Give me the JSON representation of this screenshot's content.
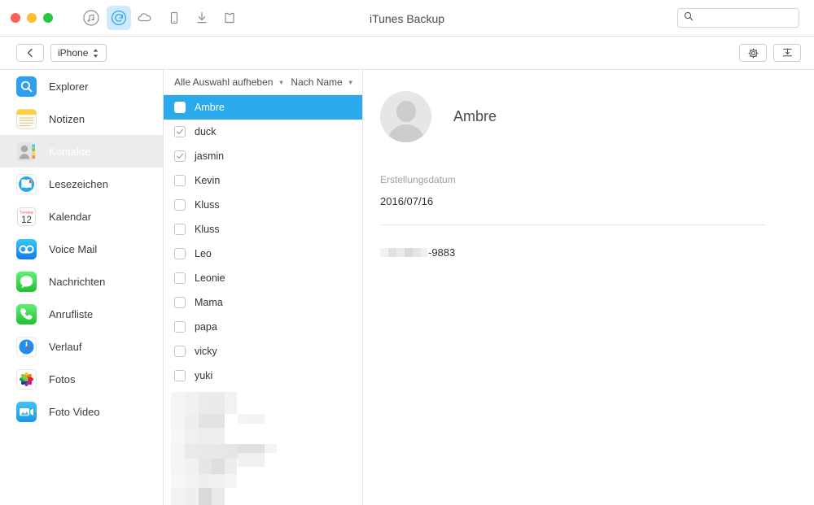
{
  "window": {
    "title": "iTunes Backup",
    "traffic_lights": [
      "close",
      "minimize",
      "maximize"
    ],
    "colors": {
      "close": "#ff5f57",
      "minimize": "#febc2e",
      "maximize": "#28c840",
      "accent": "#2aa9ec",
      "active_tool_bg": "#cfe8fb"
    }
  },
  "toolbar": {
    "items": [
      {
        "name": "music-icon",
        "label": "Music"
      },
      {
        "name": "backup-restore-icon",
        "label": "iTunes Backup",
        "active": true
      },
      {
        "name": "cloud-icon",
        "label": "iCloud"
      },
      {
        "name": "device-icon",
        "label": "Device"
      },
      {
        "name": "download-icon",
        "label": "Download"
      },
      {
        "name": "shirt-icon",
        "label": "Toolkit"
      }
    ]
  },
  "search": {
    "value": "",
    "placeholder": ""
  },
  "subbar": {
    "back_label": "",
    "device_label": "iPhone",
    "settings_label": "",
    "export_label": ""
  },
  "sidebar": {
    "items": [
      {
        "label": "Explorer",
        "icon": "explorer-icon",
        "selected": false
      },
      {
        "label": "Notizen",
        "icon": "notes-icon",
        "selected": false
      },
      {
        "label": "Kontakte",
        "icon": "contacts-icon",
        "selected": true
      },
      {
        "label": "Lesezeichen",
        "icon": "bookmarks-icon",
        "selected": false
      },
      {
        "label": "Kalendar",
        "icon": "calendar-icon",
        "selected": false
      },
      {
        "label": "Voice Mail",
        "icon": "voicemail-icon",
        "selected": false
      },
      {
        "label": "Nachrichten",
        "icon": "messages-icon",
        "selected": false
      },
      {
        "label": "Anrufliste",
        "icon": "call-history-icon",
        "selected": false
      },
      {
        "label": "Verlauf",
        "icon": "history-icon",
        "selected": false
      },
      {
        "label": "Fotos",
        "icon": "photos-icon",
        "selected": false
      },
      {
        "label": "Foto Video",
        "icon": "photo-video-icon",
        "selected": false
      }
    ],
    "calendar_icon_day": "12",
    "calendar_icon_weekday": "Tuesday"
  },
  "list": {
    "header": {
      "deselect_all_label": "Alle Auswahl aufheben",
      "sort_label": "Nach Name"
    },
    "rows": [
      {
        "name": "Ambre",
        "checked": true,
        "selected": true
      },
      {
        "name": "duck",
        "checked": true,
        "selected": false
      },
      {
        "name": "jasmin",
        "checked": true,
        "selected": false
      },
      {
        "name": "Kevin",
        "checked": false,
        "selected": false
      },
      {
        "name": "Kluss",
        "checked": false,
        "selected": false
      },
      {
        "name": "Kluss",
        "checked": false,
        "selected": false
      },
      {
        "name": "Leo",
        "checked": false,
        "selected": false
      },
      {
        "name": "Leonie",
        "checked": false,
        "selected": false
      },
      {
        "name": "Mama",
        "checked": false,
        "selected": false
      },
      {
        "name": "papa",
        "checked": false,
        "selected": false
      },
      {
        "name": "vicky",
        "checked": false,
        "selected": false
      },
      {
        "name": "yuki",
        "checked": false,
        "selected": false
      }
    ],
    "redacted_region": true
  },
  "detail": {
    "contact_name": "Ambre",
    "avatar": "placeholder-person-avatar",
    "created_label": "Erstellungsdatum",
    "created_value": "2016/07/16",
    "phone_suffix": "-9883",
    "phone_prefix_redacted": true
  }
}
